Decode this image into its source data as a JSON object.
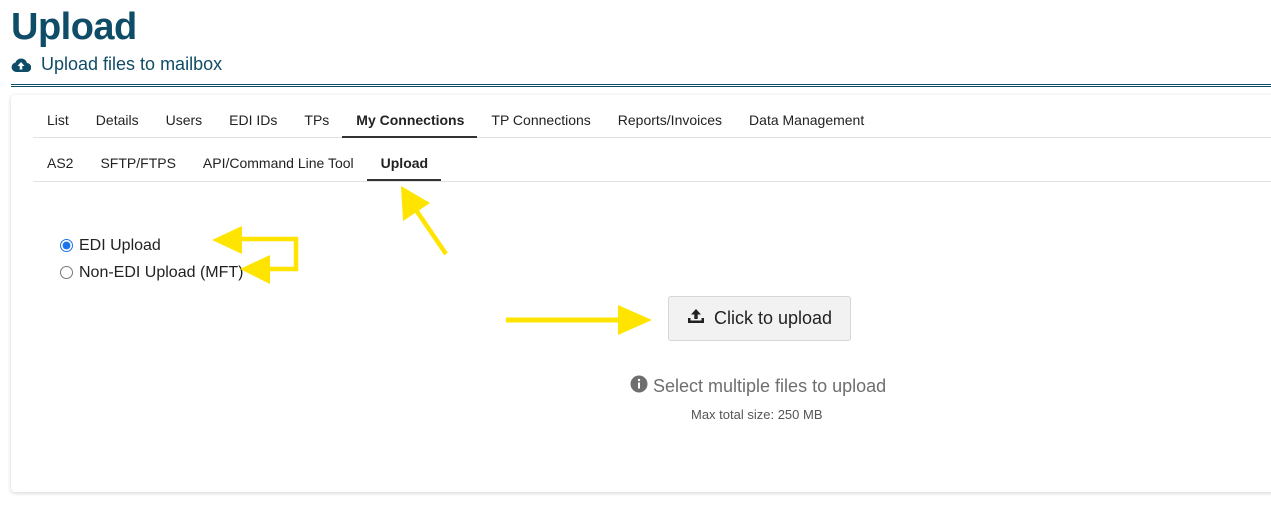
{
  "header": {
    "title": "Upload",
    "subtitle": "Upload files to mailbox",
    "subtitle_icon": "cloud-upload-icon"
  },
  "tabs_primary": [
    {
      "label": "List",
      "active": false
    },
    {
      "label": "Details",
      "active": false
    },
    {
      "label": "Users",
      "active": false
    },
    {
      "label": "EDI IDs",
      "active": false
    },
    {
      "label": "TPs",
      "active": false
    },
    {
      "label": "My Connections",
      "active": true
    },
    {
      "label": "TP Connections",
      "active": false
    },
    {
      "label": "Reports/Invoices",
      "active": false
    },
    {
      "label": "Data Management",
      "active": false
    }
  ],
  "tabs_secondary": [
    {
      "label": "AS2",
      "active": false
    },
    {
      "label": "SFTP/FTPS",
      "active": false
    },
    {
      "label": "API/Command Line Tool",
      "active": false
    },
    {
      "label": "Upload",
      "active": true
    }
  ],
  "upload_type": {
    "options": [
      {
        "label": "EDI Upload",
        "checked": true
      },
      {
        "label": "Non-EDI Upload (MFT)",
        "checked": false
      }
    ]
  },
  "upload": {
    "button_label": "Click to upload",
    "button_icon": "upload-icon",
    "hint": "Select multiple files to upload",
    "hint_icon": "info-icon",
    "max_size": "Max total size: 250 MB"
  },
  "colors": {
    "brand": "#0f4c67",
    "annotation": "#ffe400"
  }
}
